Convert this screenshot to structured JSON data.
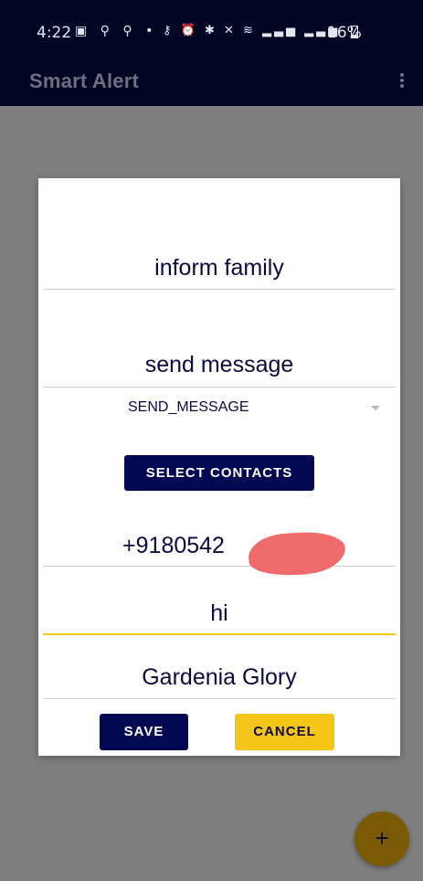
{
  "status_bar": {
    "time": "4:22",
    "left_icons": "▣ ⚲ ⚲ •",
    "right_icons": "⚷ ⏰ ✱ ✕ ≋ ▂▃▅ ▂▃▅",
    "battery": "16%"
  },
  "app_bar": {
    "title": "Smart Alert",
    "menu_icon": "kebab-menu-icon"
  },
  "dialog": {
    "alert_name": "inform family",
    "action_label": "send message",
    "action_type": "SEND_MESSAGE",
    "select_contacts_label": "SELECT CONTACTS",
    "phone_number": "+9180542",
    "message": "hi",
    "location": "Gardenia Glory",
    "save_label": "SAVE",
    "cancel_label": "CANCEL"
  },
  "fab": {
    "label": "+"
  },
  "colors": {
    "app_bar_bg": "#020524",
    "primary_button": "#020852",
    "accent": "#f5c518",
    "redaction": "#ef6b6b",
    "scrim": "#7f7f7f"
  }
}
